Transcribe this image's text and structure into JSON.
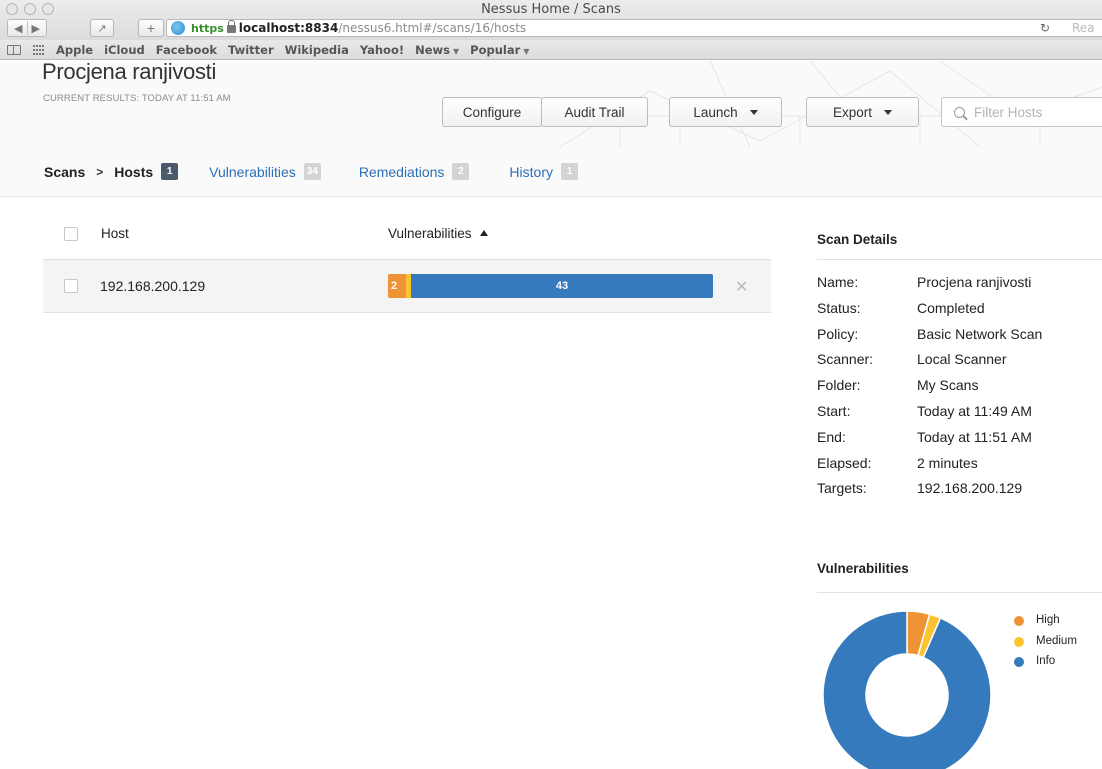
{
  "window": {
    "title": "Nessus Home / Scans"
  },
  "browser": {
    "url_scheme": "https",
    "url_host": "localhost:8834",
    "url_path": "/nessus6.html#/scans/16/hosts",
    "reader_label": "Rea",
    "bookmarks": [
      "Apple",
      "iCloud",
      "Facebook",
      "Twitter",
      "Wikipedia",
      "Yahoo!",
      "News",
      "Popular"
    ],
    "bookmark_dropdown_caret": "▼"
  },
  "header": {
    "title": "Procjena ranjivosti",
    "subtitle": "CURRENT RESULTS: TODAY AT 11:51 AM",
    "buttons": {
      "configure": "Configure",
      "audit_trail": "Audit Trail",
      "launch": "Launch",
      "export": "Export"
    },
    "filter_placeholder": "Filter Hosts"
  },
  "tabs": {
    "scans": "Scans",
    "separator": ">",
    "hosts": {
      "label": "Hosts",
      "count": "1"
    },
    "vulnerabilities": {
      "label": "Vulnerabilities",
      "count": "34"
    },
    "remediations": {
      "label": "Remediations",
      "count": "2"
    },
    "history": {
      "label": "History",
      "count": "1"
    }
  },
  "hosts_table": {
    "columns": {
      "host": "Host",
      "vulnerabilities": "Vulnerabilities"
    },
    "rows": [
      {
        "host": "192.168.200.129",
        "high": 2,
        "medium": 1,
        "info": 43,
        "high_label": "2",
        "info_label": "43"
      }
    ]
  },
  "scan_details": {
    "heading": "Scan Details",
    "fields": [
      {
        "label": "Name:",
        "value": "Procjena ranjivosti"
      },
      {
        "label": "Status:",
        "value": "Completed"
      },
      {
        "label": "Policy:",
        "value": "Basic Network Scan"
      },
      {
        "label": "Scanner:",
        "value": "Local Scanner"
      },
      {
        "label": "Folder:",
        "value": "My Scans"
      },
      {
        "label": "Start:",
        "value": "Today at 11:49 AM"
      },
      {
        "label": "End:",
        "value": "Today at 11:51 AM"
      },
      {
        "label": "Elapsed:",
        "value": "2 minutes"
      },
      {
        "label": "Targets:",
        "value": "192.168.200.129"
      }
    ]
  },
  "vuln_chart": {
    "heading": "Vulnerabilities",
    "legend": [
      {
        "label": "High",
        "color": "#ee9336"
      },
      {
        "label": "Medium",
        "color": "#fdc431"
      },
      {
        "label": "Info",
        "color": "#357abd"
      }
    ]
  },
  "chart_data": {
    "type": "pie",
    "categories": [
      "High",
      "Medium",
      "Info"
    ],
    "values": [
      2,
      1,
      43
    ],
    "colors": [
      "#ee9336",
      "#fdc431",
      "#357abd"
    ]
  },
  "colors": {
    "link": "#2c6fb6",
    "high": "#ee9336",
    "medium": "#fdc431",
    "info": "#357abd"
  }
}
